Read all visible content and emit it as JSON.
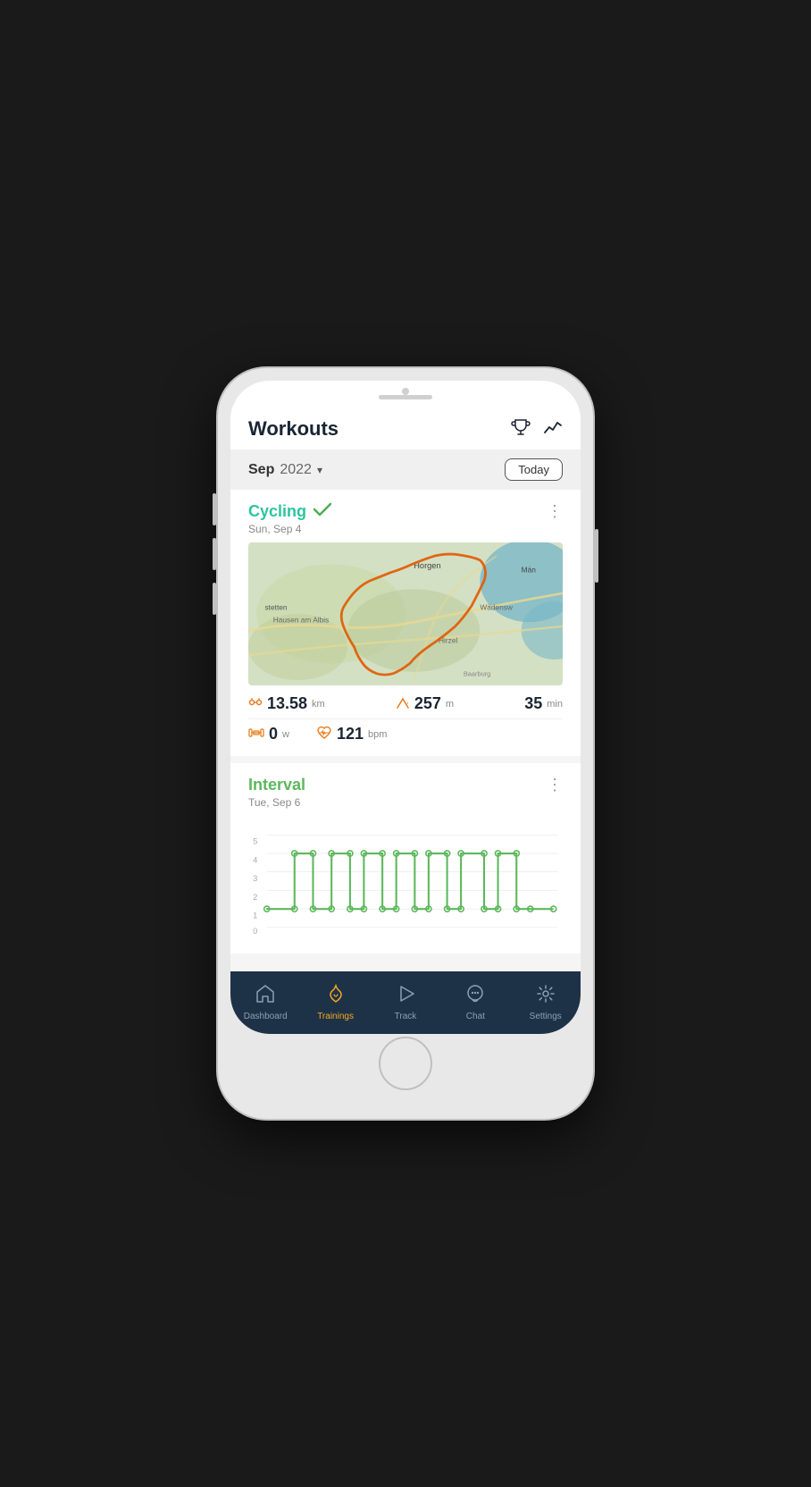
{
  "header": {
    "title": "Workouts",
    "trophy_icon": "🏆",
    "chart_icon": "📈"
  },
  "date_bar": {
    "month": "Sep",
    "year": "2022",
    "today_label": "Today"
  },
  "workouts": [
    {
      "id": "cycling",
      "title": "Cycling",
      "completed": true,
      "date": "Sun, Sep 4",
      "stats": {
        "distance_value": "13.58",
        "distance_unit": "km",
        "elevation_value": "257",
        "elevation_unit": "m",
        "time_value": "35",
        "time_unit": "min",
        "power_value": "0",
        "power_unit": "w",
        "hr_value": "121",
        "hr_unit": "bpm"
      }
    },
    {
      "id": "interval",
      "title": "Interval",
      "completed": false,
      "date": "Tue, Sep 6"
    }
  ],
  "bottom_nav": {
    "items": [
      {
        "id": "dashboard",
        "label": "Dashboard",
        "icon": "🏠",
        "active": false
      },
      {
        "id": "trainings",
        "label": "Trainings",
        "icon": "🍦",
        "active": true
      },
      {
        "id": "track",
        "label": "Track",
        "icon": "▶",
        "active": false
      },
      {
        "id": "chat",
        "label": "Chat",
        "icon": "💬",
        "active": false
      },
      {
        "id": "settings",
        "label": "Settings",
        "icon": "⚙",
        "active": false
      }
    ]
  }
}
